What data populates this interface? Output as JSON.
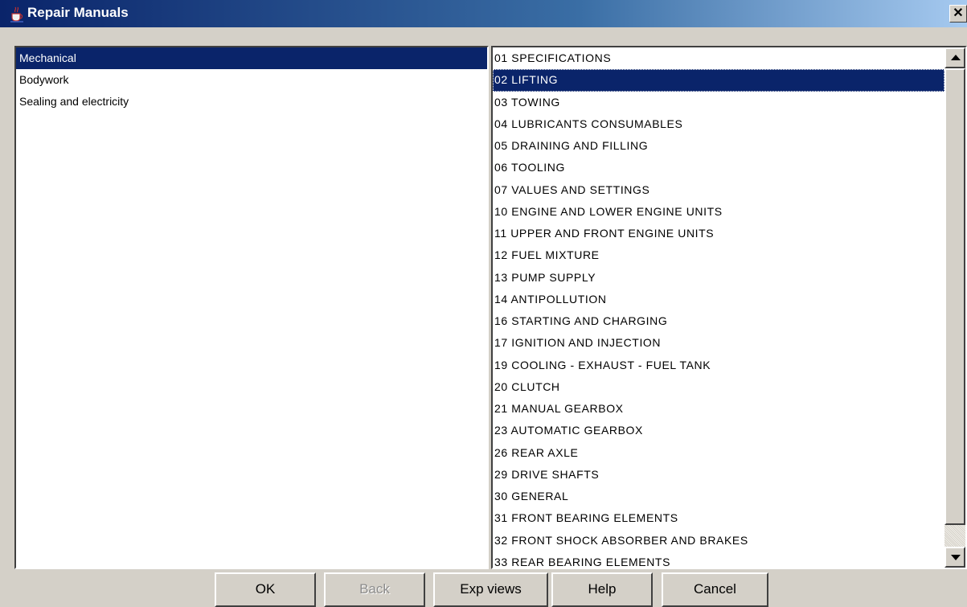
{
  "window": {
    "title": "Repair Manuals",
    "close_label": "✕"
  },
  "categories": [
    {
      "label": "Mechanical",
      "selected": true
    },
    {
      "label": "Bodywork",
      "selected": false
    },
    {
      "label": "Sealing and electricity",
      "selected": false
    }
  ],
  "sections": [
    {
      "label": "01 SPECIFICATIONS",
      "selected": false
    },
    {
      "label": "02 LIFTING",
      "selected": true
    },
    {
      "label": "03 TOWING",
      "selected": false
    },
    {
      "label": "04 LUBRICANTS CONSUMABLES",
      "selected": false
    },
    {
      "label": "05 DRAINING AND FILLING",
      "selected": false
    },
    {
      "label": "06 TOOLING",
      "selected": false
    },
    {
      "label": "07 VALUES AND SETTINGS",
      "selected": false
    },
    {
      "label": "10 ENGINE AND LOWER ENGINE UNITS",
      "selected": false
    },
    {
      "label": "11 UPPER AND FRONT ENGINE UNITS",
      "selected": false
    },
    {
      "label": "12 FUEL MIXTURE",
      "selected": false
    },
    {
      "label": "13 PUMP SUPPLY",
      "selected": false
    },
    {
      "label": "14 ANTIPOLLUTION",
      "selected": false
    },
    {
      "label": "16 STARTING AND CHARGING",
      "selected": false
    },
    {
      "label": "17 IGNITION AND INJECTION",
      "selected": false
    },
    {
      "label": "19 COOLING - EXHAUST - FUEL TANK",
      "selected": false
    },
    {
      "label": "20 CLUTCH",
      "selected": false
    },
    {
      "label": "21 MANUAL GEARBOX",
      "selected": false
    },
    {
      "label": "23 AUTOMATIC GEARBOX",
      "selected": false
    },
    {
      "label": "26 REAR AXLE",
      "selected": false
    },
    {
      "label": "29 DRIVE SHAFTS",
      "selected": false
    },
    {
      "label": "30 GENERAL",
      "selected": false
    },
    {
      "label": "31 FRONT BEARING ELEMENTS",
      "selected": false
    },
    {
      "label": "32 FRONT SHOCK ABSORBER AND BRAKES",
      "selected": false
    },
    {
      "label": "33 REAR BEARING ELEMENTS",
      "selected": false
    }
  ],
  "buttons": {
    "ok": "OK",
    "back": "Back",
    "exp_views": "Exp views",
    "help": "Help",
    "cancel": "Cancel"
  },
  "colors": {
    "selection": "#0a246a",
    "face": "#d4d0c8"
  },
  "icons": {
    "app": "java-cup-icon",
    "close": "close-icon",
    "scroll_up": "arrow-up-icon",
    "scroll_down": "arrow-down-icon"
  }
}
